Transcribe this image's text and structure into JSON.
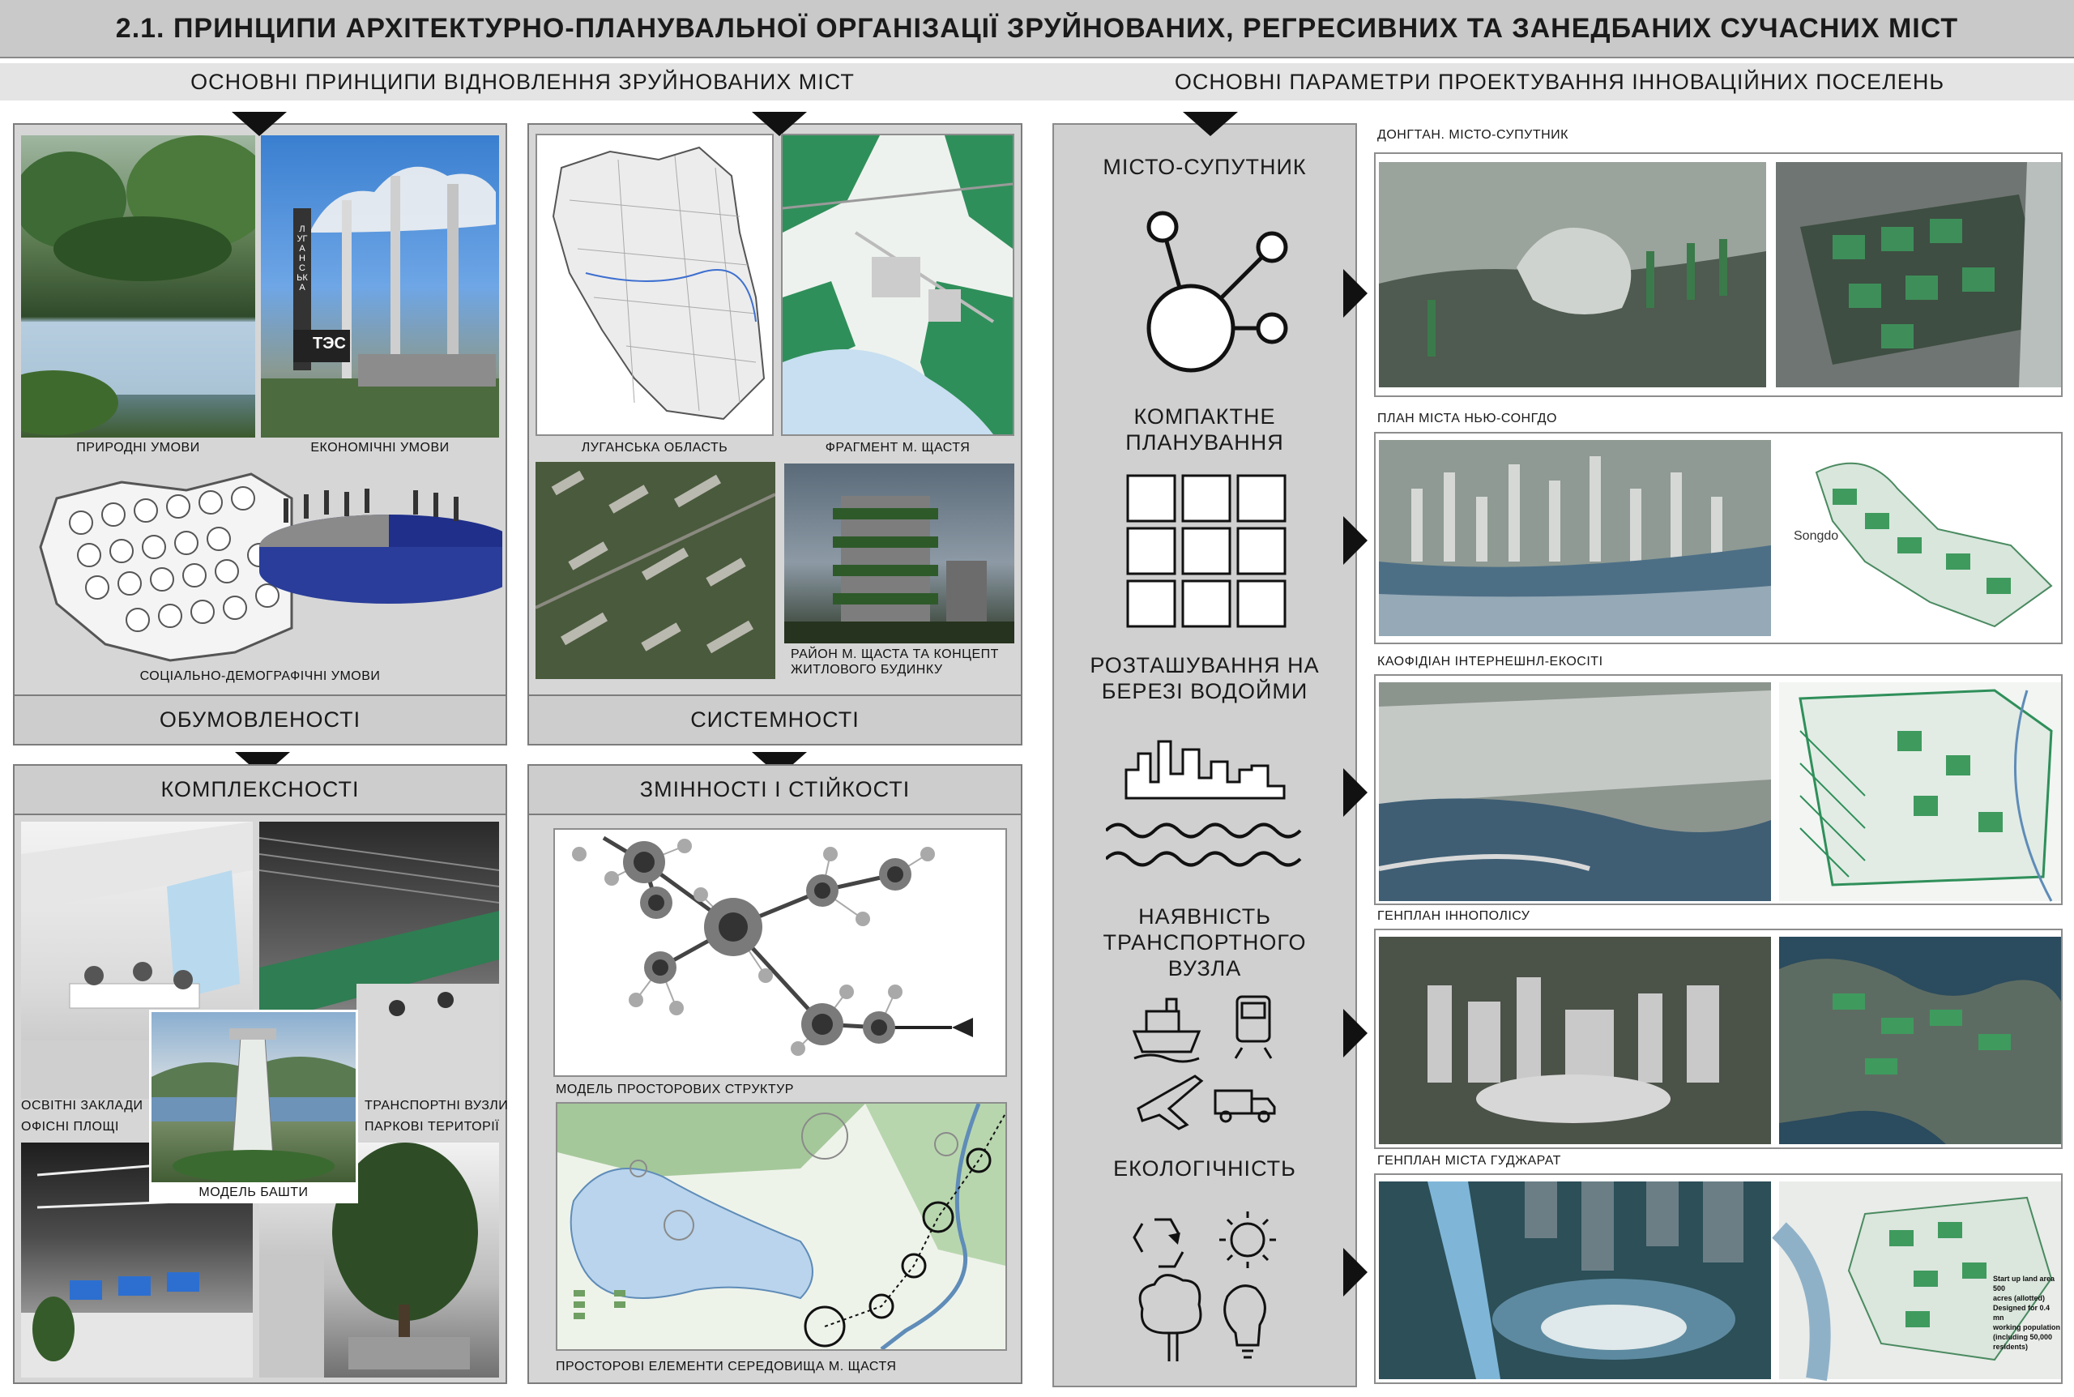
{
  "header": {
    "title": "2.1. ПРИНЦИПИ АРХІТЕКТУРНО-ПЛАНУВАЛЬНОЇ ОРГАНІЗАЦІЇ ЗРУЙНОВАНИХ, РЕГРЕСИВНИХ ТА ЗАНЕДБАНИХ СУЧАСНИХ МІСТ"
  },
  "left_section": {
    "heading": "ОСНОВНІ  ПРИНЦИПИ ВІДНОВЛЕННЯ ЗРУЙНОВАНИХ МІСТ",
    "panels": {
      "conditions": {
        "label": "ОБУМОВЛЕНОСТІ",
        "captions": [
          "ПРИРОДНІ УМОВИ",
          "ЕКОНОМІЧНІ УМОВИ",
          "СОЦІАЛЬНО-ДЕМОГРАФІЧНІ УМОВИ"
        ],
        "plant_sign_vertical": "ЛУГАНСЬКА",
        "plant_sign": "ТЭС"
      },
      "systemic": {
        "label": "СИСТЕМНОСТІ",
        "captions": [
          "ЛУГАНСЬКА ОБЛАСТЬ",
          "ФРАГМЕНТ М. ЩАСТЯ",
          "РАЙОН М. ЩАСТА ТА КОНЦЕПТ ЖИТЛОВОГО БУДИНКУ"
        ]
      },
      "complexity": {
        "label": "КОМПЛЕКСНОСТІ",
        "captions": [
          "ОСВІТНІ ЗАКЛАДИ",
          "ОФІСНІ ПЛОЩІ",
          "ТРАНСПОРТНІ ВУЗЛИ",
          "ПАРКОВІ ТЕРИТОРІЇ",
          "МОДЕЛЬ БАШТИ"
        ]
      },
      "variability": {
        "label": "ЗМІННОСТІ І СТІЙКОСТІ",
        "captions": [
          "МОДЕЛЬ ПРОСТОРОВИХ СТРУКТУР",
          "ПРОСТОРОВІ ЕЛЕМЕНТИ СЕРЕДОВИЩА М. ЩАСТЯ"
        ]
      }
    }
  },
  "right_section": {
    "heading": "ОСНОВНІ  ПАРАМЕТРИ ПРОЕКТУВАННЯ ІННОВАЦІЙНИХ ПОСЕЛЕНЬ",
    "parameters": [
      {
        "label": "МІСТО-СУПУТНИК",
        "icon": "satellite-city-icon"
      },
      {
        "label": "КОМПАКТНЕ ПЛАНУВАННЯ",
        "icon": "grid-plan-icon"
      },
      {
        "label": "РОЗТАШУВАННЯ НА БЕРЕЗІ ВОДОЙМИ",
        "icon": "waterfront-skyline-icon"
      },
      {
        "label": "НАЯВНІСТЬ ТРАНСПОРТНОГО ВУЗЛА",
        "icon": "transport-icons"
      },
      {
        "label": "ЕКОЛОГІЧНІСТЬ",
        "icon": "ecology-icons"
      }
    ],
    "projects": [
      {
        "title": "ДОНГТАН. МІСТО-СУПУТНИК"
      },
      {
        "title": "ПЛАН МІСТА НЬЮ-СОНГДО",
        "map_brand": "Songdo"
      },
      {
        "title": "КАОФІДІАН ІНТЕРНЕШНЛ-ЕКОСІТІ"
      },
      {
        "title": "ГЕНПЛАН ІННОПОЛІСУ"
      },
      {
        "title": "ГЕНПЛАН МІСТА ГУДЖАРАТ",
        "map_notes": [
          "Start up land area 500",
          "acres (allotted)",
          "Designed for 0.4 mn",
          "working population",
          "(including 50,000",
          "residents)"
        ]
      }
    ]
  },
  "colors": {
    "accent_green": "#2f8f5a",
    "panel_gray": "#d6d6d6",
    "header_gray": "#c9c9c9"
  }
}
